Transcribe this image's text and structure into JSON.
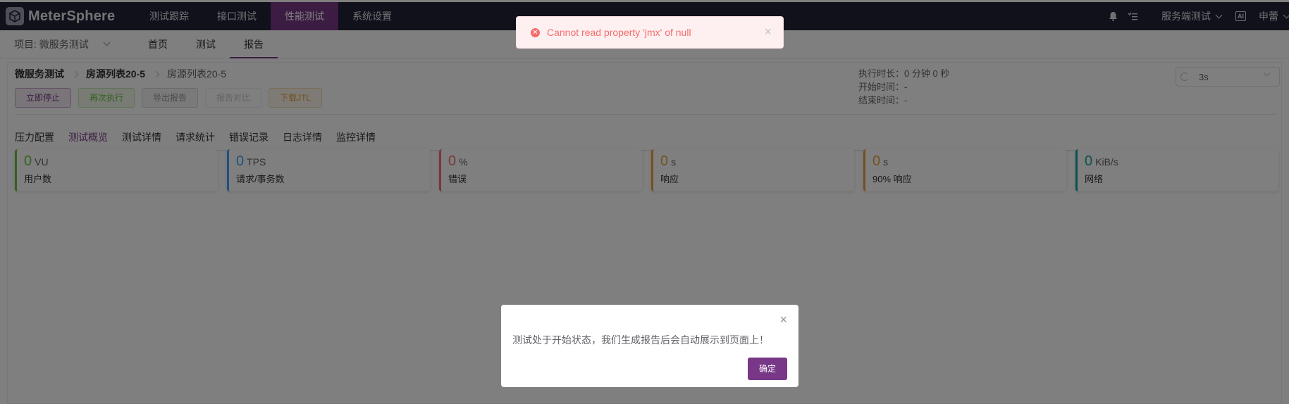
{
  "header": {
    "brand": "MeterSphere",
    "nav": [
      "测试跟踪",
      "接口测试",
      "性能测试",
      "系统设置"
    ],
    "active_nav_index": 2,
    "workspace": "服务端测试",
    "language": "AI",
    "user": "申蕾"
  },
  "subnav": {
    "project": "项目: 微服务测试",
    "items": [
      "首页",
      "测试",
      "报告"
    ],
    "active_index": 2
  },
  "report": {
    "breadcrumb": [
      "微服务测试",
      "房源列表20-5",
      "房源列表20-5"
    ],
    "buttons": {
      "stop": "立即停止",
      "rerun": "再次执行",
      "export": "导出报告",
      "compare": "报告对比",
      "download": "下载JTL"
    },
    "exec_duration": "执行时长：0 分钟 0 秒",
    "start_time": "开始时间：-",
    "end_time": "结束时间：-",
    "refresh_interval": "3s",
    "tabs": [
      "压力配置",
      "测试概览",
      "测试详情",
      "请求统计",
      "错误记录",
      "日志详情",
      "监控详情"
    ],
    "active_tab_index": 1,
    "cards": [
      {
        "value": "0",
        "unit": "VU",
        "label": "用户数",
        "color": "#67c23a"
      },
      {
        "value": "0",
        "unit": "TPS",
        "label": "请求/事务数",
        "color": "#409eff"
      },
      {
        "value": "0",
        "unit": "%",
        "label": "错误",
        "color": "#f56c6c"
      },
      {
        "value": "0",
        "unit": "s",
        "label": "响应",
        "color": "#e6a23c"
      },
      {
        "value": "0",
        "unit": "s",
        "label": "90% 响应",
        "color": "#e6a23c"
      },
      {
        "value": "0",
        "unit": "KiB/s",
        "label": "网络",
        "color": "#17a2a2"
      }
    ]
  },
  "toast": {
    "message": "Cannot read property 'jmx' of null"
  },
  "dialog": {
    "message": "测试处于开始状态，我们生成报告后会自动展示到页面上！",
    "confirm": "确定"
  },
  "colors": {
    "brand": "#783887",
    "header_bg": "#212334",
    "error": "#f56c6c"
  }
}
